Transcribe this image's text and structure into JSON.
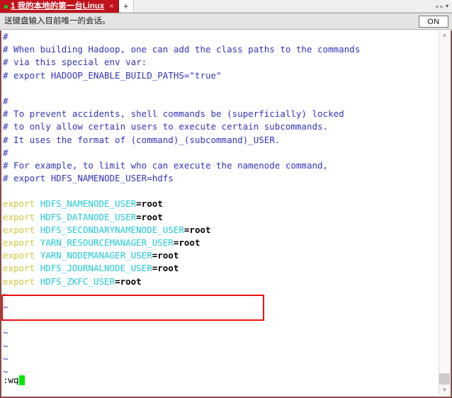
{
  "window": {
    "accent_red": "#c1121c",
    "border_color": "#8a4a4a"
  },
  "tabbar": {
    "tab": {
      "title": "1 我的本地的第一台Linux",
      "status_dot": "connected-dot",
      "close_label": "×"
    },
    "new_tab_label": "+",
    "nav_prev_label": "◂",
    "nav_next_label": "▸",
    "nav_menu_label": "▾"
  },
  "toolbar": {
    "label": "送键盘输入目前唯一的会话。",
    "toggle_label": "ON"
  },
  "terminal": {
    "lines": [
      {
        "type": "comment",
        "text": "#"
      },
      {
        "type": "comment",
        "text": "# When building Hadoop, one can add the class paths to the commands"
      },
      {
        "type": "comment",
        "text": "# via this special env var:"
      },
      {
        "type": "comment",
        "text": "# export HADOOP_ENABLE_BUILD_PATHS=\"true\""
      },
      {
        "type": "blank",
        "text": ""
      },
      {
        "type": "comment",
        "text": "#"
      },
      {
        "type": "comment",
        "text": "# To prevent accidents, shell commands be (superficially) locked"
      },
      {
        "type": "comment",
        "text": "# to only allow certain users to execute certain subcommands."
      },
      {
        "type": "comment",
        "text": "# It uses the format of (command)_(subcommand)_USER."
      },
      {
        "type": "comment",
        "text": "#"
      },
      {
        "type": "comment",
        "text": "# For example, to limit who can execute the namenode command,"
      },
      {
        "type": "comment",
        "text": "# export HDFS_NAMENODE_USER=hdfs"
      },
      {
        "type": "blank",
        "text": ""
      },
      {
        "type": "export",
        "keyword": "export",
        "variable": "HDFS_NAMENODE_USER",
        "value": "=root"
      },
      {
        "type": "export",
        "keyword": "export",
        "variable": "HDFS_DATANODE_USER",
        "value": "=root"
      },
      {
        "type": "export",
        "keyword": "export",
        "variable": "HDFS_SECONDARYNAMENODE_USER",
        "value": "=root"
      },
      {
        "type": "export",
        "keyword": "export",
        "variable": "YARN_RESOURCEMANAGER_USER",
        "value": "=root"
      },
      {
        "type": "export",
        "keyword": "export",
        "variable": "YARN_NODEMANAGER_USER",
        "value": "=root"
      },
      {
        "type": "export",
        "keyword": "export",
        "variable": "HDFS_JOURNALNODE_USER",
        "value": "=root"
      },
      {
        "type": "export",
        "keyword": "export",
        "variable": "HDFS_ZKFC_USER",
        "value": "=root"
      },
      {
        "type": "tilde",
        "text": "~"
      },
      {
        "type": "tilde",
        "text": "~"
      },
      {
        "type": "tilde",
        "text": "~"
      },
      {
        "type": "tilde",
        "text": "~"
      },
      {
        "type": "tilde",
        "text": "~"
      },
      {
        "type": "tilde",
        "text": "~"
      },
      {
        "type": "tilde",
        "text": "~"
      }
    ],
    "status_command": ":wq",
    "cursor": "block-cursor",
    "colors": {
      "comment": "#3333bb",
      "keyword": "#cfc83c",
      "variable": "#1fc8d6",
      "value": "#000000",
      "cursor": "#00e800",
      "annotation": "#ee1111"
    }
  },
  "annotation": {
    "name": "red-highlight-box",
    "covers": [
      "HDFS_JOURNALNODE_USER=root",
      "HDFS_ZKFC_USER=root"
    ]
  },
  "scrollbar": {
    "up_arrow": "˄",
    "down_arrow": "˅"
  }
}
